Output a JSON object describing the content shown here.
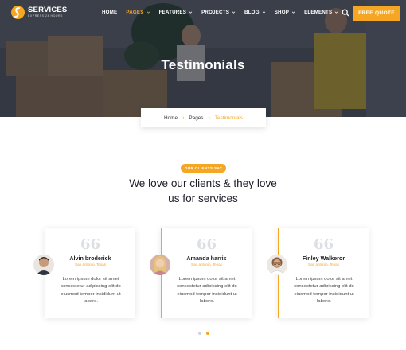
{
  "brand": {
    "name": "SERVICES",
    "tagline": "EXPRESS 24 HOURS",
    "accent": "#f5a623"
  },
  "nav": {
    "items": [
      {
        "label": "HOME",
        "active": false
      },
      {
        "label": "PAGES",
        "active": true
      },
      {
        "label": "FEATURES",
        "active": false
      },
      {
        "label": "PROJECTS",
        "active": false
      },
      {
        "label": "BLOG",
        "active": false
      },
      {
        "label": "SHOP",
        "active": false
      },
      {
        "label": "ELEMENTS",
        "active": false
      }
    ],
    "quote_label": "FREE QUOTE"
  },
  "hero": {
    "title": "Testimonials"
  },
  "breadcrumb": {
    "home": "Home",
    "pages": "Pages",
    "current": "Testimonials"
  },
  "section": {
    "badge": "OUR CLIENTS SAY",
    "heading_line1": "We love our clients & they love",
    "heading_line2": "us for services"
  },
  "testimonials": [
    {
      "name": "Alvin broderick",
      "location": "San antonio, Texas",
      "text": "Lorem ipsum dolor sit amet consectetur adipiscing elit do eiusmod tempor incididunt ut labore."
    },
    {
      "name": "Amanda harris",
      "location": "San antonio, Texas",
      "text": "Lorem ipsum dolor sit amet consectetur adipiscing elit do eiusmod tempor incididunt ut labore."
    },
    {
      "name": "Finley Walkeror",
      "location": "San antonio, Texas",
      "text": "Lorem ipsum dolor sit amet consectetur adipiscing elit do eiusmod tempor incididunt ut labore."
    }
  ],
  "pagination": {
    "count": 2,
    "active_index": 1
  }
}
